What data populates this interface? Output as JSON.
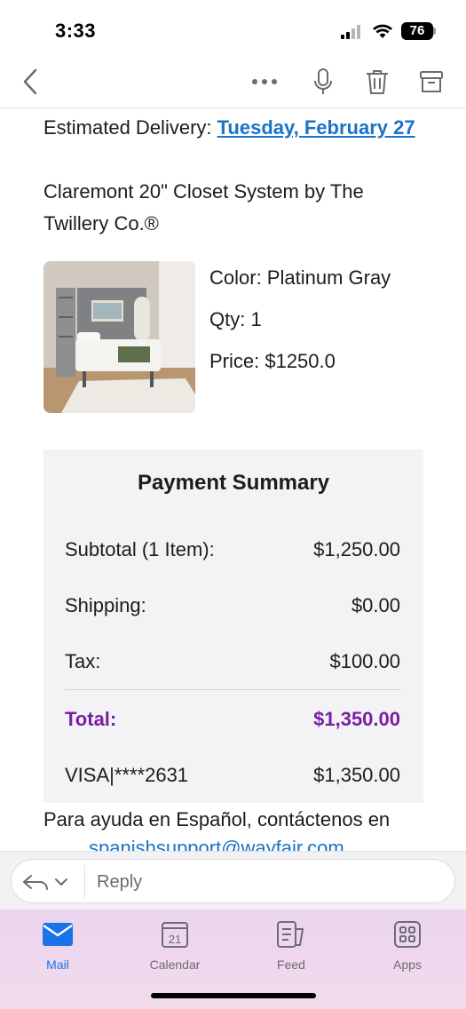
{
  "status_bar": {
    "time": "3:33",
    "battery": "76"
  },
  "toolbar": {
    "icons": [
      "back-icon",
      "more-icon",
      "microphone-icon",
      "trash-icon",
      "archive-icon"
    ]
  },
  "email": {
    "delivery_label": "Estimated Delivery: ",
    "delivery_date": "Tuesday, February 27",
    "product_name": "Claremont 20\" Closet System by The Twillery Co.®",
    "color": "Color: Platinum Gray",
    "qty": "Qty: 1",
    "price": "Price: $1250.0",
    "payment_summary": {
      "title": "Payment Summary",
      "rows": [
        {
          "label": "Subtotal (1 Item):",
          "value": "$1,250.00"
        },
        {
          "label": "Shipping:",
          "value": "$0.00"
        },
        {
          "label": "Tax:",
          "value": "$100.00"
        },
        {
          "label": "Total:",
          "value": "$1,350.00"
        },
        {
          "label": "VISA|****2631",
          "value": "$1,350.00"
        }
      ],
      "total_color": "#7b1fa2"
    },
    "spanish_help": "Para ayuda en Español, contáctenos en",
    "spanish_email": "spanishsupport@wayfair.com"
  },
  "reply": {
    "placeholder": "Reply"
  },
  "tabs": [
    {
      "label": "Mail",
      "icon": "mail-icon",
      "active": true
    },
    {
      "label": "Calendar",
      "icon": "calendar-icon",
      "day": "21"
    },
    {
      "label": "Feed",
      "icon": "feed-icon"
    },
    {
      "label": "Apps",
      "icon": "apps-icon"
    }
  ],
  "colors": {
    "accent": "#1a73e8",
    "link": "#1a73c8"
  }
}
